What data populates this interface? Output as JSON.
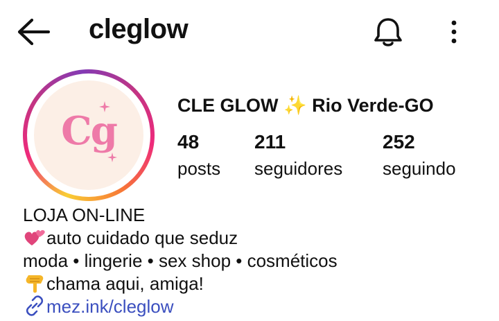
{
  "header": {
    "username": "cleglow"
  },
  "profile": {
    "display_name": "CLE GLOW ✨ Rio Verde-GO",
    "avatar_text": "Cg",
    "stats": [
      {
        "value": "48",
        "label": "posts"
      },
      {
        "value": "211",
        "label": "seguidores"
      },
      {
        "value": "252",
        "label": "seguindo"
      }
    ]
  },
  "bio": {
    "line1": "LOJA ON-LINE",
    "line2": "auto cuidado que seduz",
    "line3": "moda • lingerie • sex shop • cosméticos",
    "line4": "chama aqui, amiga!",
    "link": "mez.ink/cleglow"
  },
  "colors": {
    "text": "#111111",
    "link": "#3b4fbf",
    "avatar_bg": "#fcefe6",
    "avatar_pink": "#ee7aa8"
  },
  "icons": {
    "back": "arrow-left-icon",
    "notifications": "bell-icon",
    "more": "vertical-dots-icon",
    "heart_emoji": "two-hearts-icon",
    "pointing_emoji": "pointing-down-hand-icon",
    "link": "chain-link-icon"
  }
}
